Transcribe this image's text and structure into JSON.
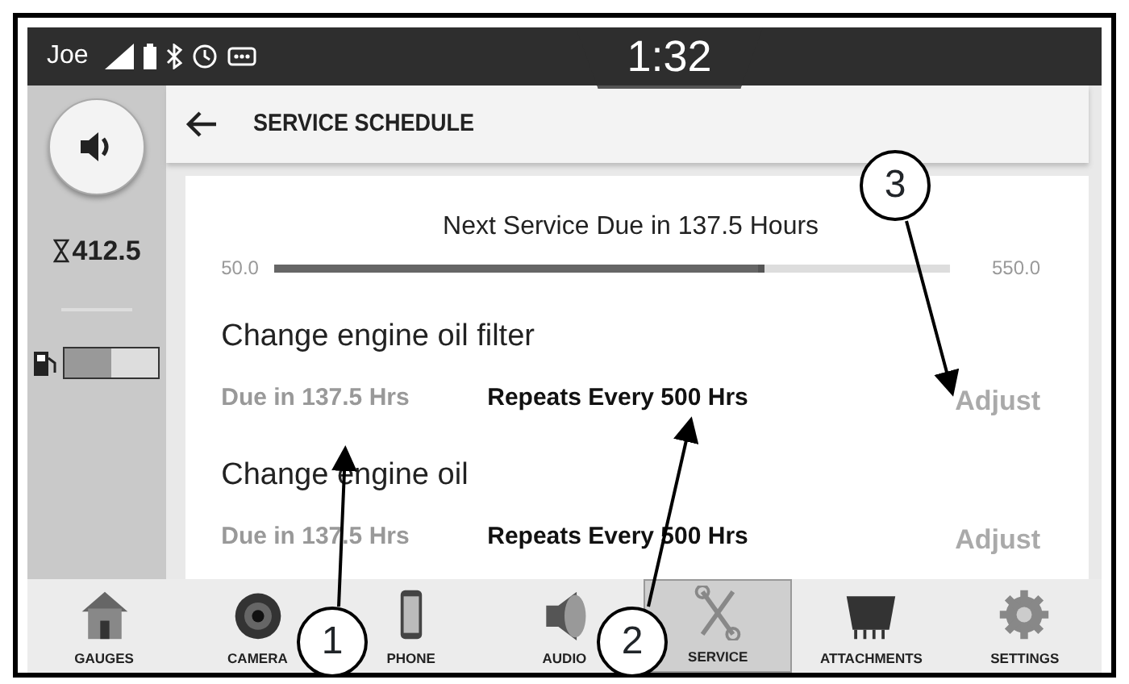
{
  "status_bar": {
    "user": "Joe",
    "time": "1:32"
  },
  "sidebar": {
    "hours": "412.5",
    "fuel": {
      "level": 0.5
    }
  },
  "header": {
    "title": "SERVICE SCHEDULE"
  },
  "next_service": {
    "title": "Next Service Due in 137.5 Hours",
    "min": "50.0",
    "max": "550.0",
    "level": 0.725
  },
  "tasks": [
    {
      "name": "Change engine oil filter",
      "due": "Due in 137.5 Hrs",
      "repeats": "Repeats Every 500 Hrs",
      "action": "Adjust"
    },
    {
      "name": "Change engine oil",
      "due": "Due in 137.5 Hrs",
      "repeats": "Repeats Every 500 Hrs",
      "action": "Adjust"
    }
  ],
  "nav": [
    {
      "label": "GAUGES",
      "selected": false
    },
    {
      "label": "CAMERA",
      "selected": false
    },
    {
      "label": "PHONE",
      "selected": false
    },
    {
      "label": "AUDIO",
      "selected": false
    },
    {
      "label": "SERVICE",
      "selected": true
    },
    {
      "label": "ATTACHMENTS",
      "selected": false
    },
    {
      "label": "SETTINGS",
      "selected": false
    }
  ],
  "callouts": [
    "1",
    "2",
    "3"
  ]
}
